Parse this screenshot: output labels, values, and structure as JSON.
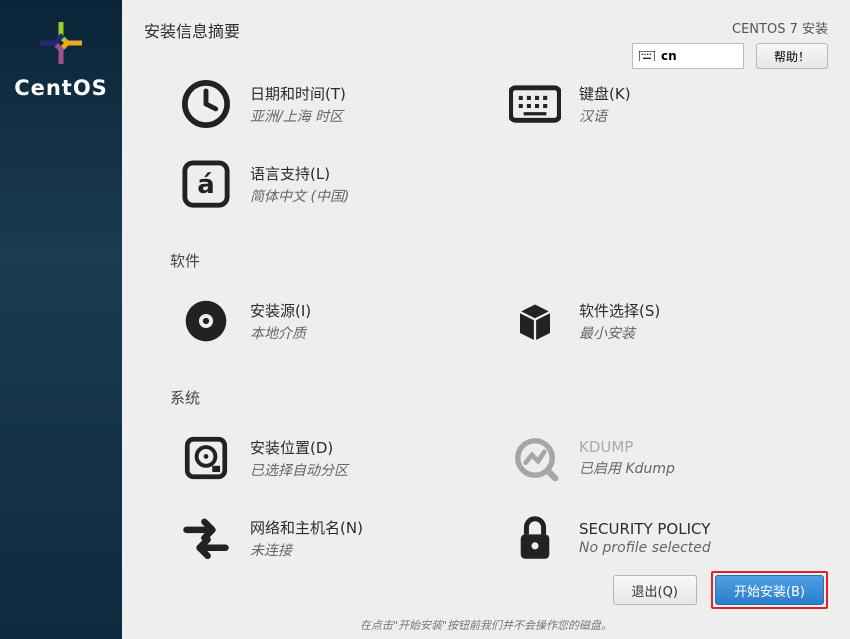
{
  "sidebar": {
    "brand": "CentOS"
  },
  "header": {
    "title": "安装信息摘要",
    "product": "CENTOS 7 安装",
    "keyboard_indicator": "cn",
    "help_label": "帮助！"
  },
  "sections": {
    "localization": {
      "datetime": {
        "title": "日期和时间(T)",
        "sub": "亚洲/上海 时区"
      },
      "keyboard": {
        "title": "键盘(K)",
        "sub": "汉语"
      },
      "language": {
        "title": "语言支持(L)",
        "sub": "简体中文 (中国)"
      }
    },
    "software_label": "软件",
    "software": {
      "source": {
        "title": "安装源(I)",
        "sub": "本地介质"
      },
      "selection": {
        "title": "软件选择(S)",
        "sub": "最小安装"
      }
    },
    "system_label": "系统",
    "system": {
      "dest": {
        "title": "安装位置(D)",
        "sub": "已选择自动分区"
      },
      "kdump": {
        "title": "KDUMP",
        "sub": "已启用 Kdump"
      },
      "network": {
        "title": "网络和主机名(N)",
        "sub": "未连接"
      },
      "security": {
        "title": "SECURITY POLICY",
        "sub": "No profile selected"
      }
    }
  },
  "footer": {
    "quit": "退出(Q)",
    "begin": "开始安装(B)",
    "note": "在点击\"开始安装\"按钮前我们并不会操作您的磁盘。"
  }
}
